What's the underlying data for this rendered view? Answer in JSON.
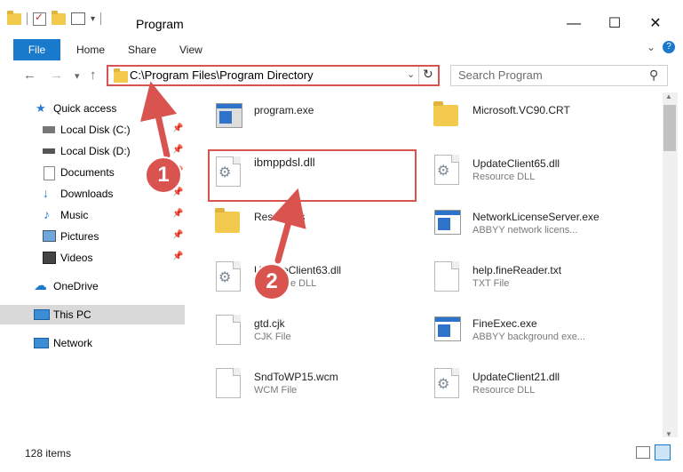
{
  "window": {
    "title": "Program",
    "minimize": "—",
    "maximize": "☐",
    "close": "✕"
  },
  "ribbon": {
    "file": "File",
    "tabs": [
      "Home",
      "Share",
      "View"
    ]
  },
  "nav": {
    "back": "←",
    "forward": "→",
    "recent": "▾",
    "up": "↑",
    "address": "C:\\Program Files\\Program Directory",
    "search_placeholder": "Search Program"
  },
  "sidebar": {
    "items": [
      {
        "label": "Quick access",
        "icon": "star-icon",
        "pinned": false
      },
      {
        "label": "Local Disk (C:)",
        "icon": "drive-icon",
        "pinned": true
      },
      {
        "label": "Local Disk (D:)",
        "icon": "drive-icon",
        "pinned": true
      },
      {
        "label": "Documents",
        "icon": "documents-icon",
        "pinned": true
      },
      {
        "label": "Downloads",
        "icon": "download-icon",
        "pinned": true
      },
      {
        "label": "Music",
        "icon": "music-icon",
        "pinned": true
      },
      {
        "label": "Pictures",
        "icon": "pictures-icon",
        "pinned": true
      },
      {
        "label": "Videos",
        "icon": "videos-icon",
        "pinned": true
      },
      {
        "label": "OneDrive",
        "icon": "cloud-icon",
        "pinned": false
      },
      {
        "label": "This PC",
        "icon": "computer-icon",
        "pinned": false,
        "selected": true
      },
      {
        "label": "Network",
        "icon": "network-icon",
        "pinned": false
      }
    ]
  },
  "files": {
    "left": [
      {
        "name": "program.exe",
        "type": "",
        "icon": "exe-icon"
      },
      {
        "name": "ibmppdsl.dll",
        "type": "",
        "icon": "dll-icon"
      },
      {
        "name": "Resources",
        "type": "",
        "icon": "folder-icon"
      },
      {
        "name": "UpdateClient63.dll",
        "type": "Resource DLL",
        "icon": "dll-icon"
      },
      {
        "name": "gtd.cjk",
        "type": "CJK File",
        "icon": "file-icon"
      },
      {
        "name": "SndToWP15.wcm",
        "type": "WCM File",
        "icon": "file-icon"
      }
    ],
    "right": [
      {
        "name": "Microsoft.VC90.CRT",
        "type": "",
        "icon": "folder-icon"
      },
      {
        "name": "UpdateClient65.dll",
        "type": "Resource DLL",
        "icon": "dll-icon"
      },
      {
        "name": "NetworkLicenseServer.exe",
        "type": "ABBYY network licens...",
        "icon": "app-icon"
      },
      {
        "name": "help.fineReader.txt",
        "type": "TXT File",
        "icon": "file-icon"
      },
      {
        "name": "FineExec.exe",
        "type": "ABBYY background exe...",
        "icon": "app-icon"
      },
      {
        "name": "UpdateClient21.dll",
        "type": "Resource DLL",
        "icon": "dll-icon"
      }
    ]
  },
  "status": {
    "count": "128 items"
  },
  "annotations": {
    "step1": "1",
    "step2": "2"
  },
  "colors": {
    "accent": "#1979ca",
    "annotation": "#d9534f"
  }
}
